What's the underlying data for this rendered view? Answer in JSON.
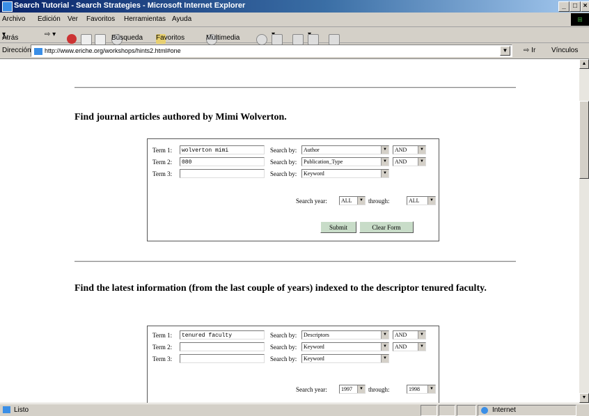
{
  "window": {
    "title": "Search Tutorial - Search Strategies - Microsoft Internet Explorer"
  },
  "menu": {
    "items": [
      "Archivo",
      "Edición",
      "Ver",
      "Favoritos",
      "Herramientas",
      "Ayuda"
    ]
  },
  "toolbar": {
    "back": "Atrás",
    "search": "Búsqueda",
    "favorites": "Favoritos",
    "multimedia": "Multimedia"
  },
  "address": {
    "label": "Dirección",
    "url": "http://www.eriche.org/workshops/hints2.html#one",
    "go": "Ir",
    "links": "Vínculos"
  },
  "example1": {
    "heading": "Find journal articles authored by Mimi Wolverton.",
    "rows": [
      {
        "term_label": "Term 1:",
        "term_value": "wolverton mimi",
        "searchby_label": "Search by:",
        "searchby_value": "Author",
        "op": "AND"
      },
      {
        "term_label": "Term 2:",
        "term_value": "080",
        "searchby_label": "Search by:",
        "searchby_value": "Publication_Type",
        "op": "AND"
      },
      {
        "term_label": "Term 3:",
        "term_value": "",
        "searchby_label": "Search by:",
        "searchby_value": "Keyword",
        "op": ""
      }
    ],
    "year_label": "Search year:",
    "year_from": "ALL",
    "through_label": "through:",
    "year_to": "ALL",
    "submit": "Submit",
    "clear": "Clear Form"
  },
  "example2": {
    "heading": "Find the latest information (from the last couple of years) indexed to the descriptor tenured faculty.",
    "rows": [
      {
        "term_label": "Term 1:",
        "term_value": "tenured faculty",
        "searchby_label": "Search by:",
        "searchby_value": "Descriptors",
        "op": "AND"
      },
      {
        "term_label": "Term 2:",
        "term_value": "",
        "searchby_label": "Search by:",
        "searchby_value": "Keyword",
        "op": "AND"
      },
      {
        "term_label": "Term 3:",
        "term_value": "",
        "searchby_label": "Search by:",
        "searchby_value": "Keyword",
        "op": ""
      }
    ],
    "year_label": "Search year:",
    "year_from": "1997",
    "through_label": "through:",
    "year_to": "1998"
  },
  "status": {
    "text": "Listo",
    "zone": "Internet"
  }
}
